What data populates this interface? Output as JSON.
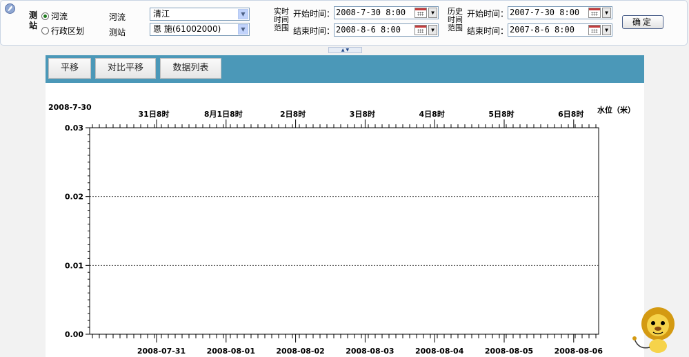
{
  "toolbar": {
    "group_label": "测站",
    "radio_river": "河流",
    "radio_region": "行政区划",
    "river_label": "河流",
    "station_label": "测站",
    "river_value": "清江",
    "station_value": "恩 施(61002000)",
    "realtime_range_label": "实时时间范围",
    "history_range_label": "历史时间范围",
    "start_label": "开始时间：",
    "end_label": "结束时间：",
    "realtime_start": "2008-7-30 8:00",
    "realtime_end": "2008-8-6 8:00",
    "history_start": "2007-7-30 8:00",
    "history_end": "2007-8-6 8:00",
    "confirm_label": "确定"
  },
  "panel": {
    "buttons": [
      "平移",
      "对比平移",
      "数据列表"
    ]
  },
  "chart_data": {
    "type": "line",
    "date_label": "2008-7-30",
    "ylabel": "水位（米）",
    "ylim": [
      0,
      0.03
    ],
    "yticks": [
      "0.00",
      "0.01",
      "0.02",
      "0.03"
    ],
    "yticks_values": [
      0,
      0.01,
      0.02,
      0.03
    ],
    "top_tick_labels": [
      "31日8时",
      "8月1日8时",
      "2日8时",
      "3日8时",
      "4日8时",
      "5日8时",
      "6日8时"
    ],
    "bottom_tick_labels": [
      "2008-07-31",
      "2008-08-01",
      "2008-08-02",
      "2008-08-03",
      "2008-08-04",
      "2008-08-05",
      "2008-08-06"
    ],
    "grid": "horizontal-dashed",
    "series": []
  },
  "colors": {
    "panel_bar": "#4b98b8",
    "radio_selected": "#1d7a1d",
    "grid_line": "#555555"
  }
}
